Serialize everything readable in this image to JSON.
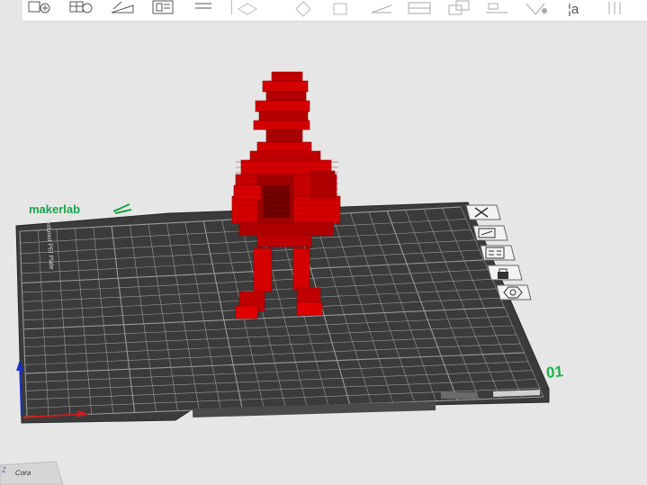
{
  "toolbar": {
    "items": [
      {
        "name": "add-object-icon",
        "label": "Add"
      },
      {
        "name": "add-plate-icon",
        "label": "Add plate"
      },
      {
        "name": "orient-icon",
        "label": "Orient"
      },
      {
        "name": "arrange-icon",
        "label": "Arrange"
      },
      {
        "name": "split-icon",
        "label": "Split"
      },
      {
        "name": "move-icon",
        "label": "Move"
      },
      {
        "name": "rotate-icon",
        "label": "Rotate"
      },
      {
        "name": "scale-icon",
        "label": "Scale"
      },
      {
        "name": "lay-on-face-icon",
        "label": "Lay on face"
      },
      {
        "name": "cut-icon",
        "label": "Cut"
      },
      {
        "name": "mesh-boolean-icon",
        "label": "Boolean"
      },
      {
        "name": "support-paint-icon",
        "label": "Supports"
      },
      {
        "name": "color-paint-icon",
        "label": "Color painting"
      },
      {
        "name": "text-icon",
        "label": "Text"
      },
      {
        "name": "measure-icon",
        "label": "Measure"
      }
    ]
  },
  "plate": {
    "brand": "makerlab",
    "number": "01",
    "side_tools": [
      {
        "name": "delete-plate-icon"
      },
      {
        "name": "orient-plate-icon"
      },
      {
        "name": "arrange-plate-icon"
      },
      {
        "name": "lock-plate-icon"
      },
      {
        "name": "plate-settings-icon"
      }
    ],
    "sheet_edge_text": "Textured PEI Plate"
  },
  "model": {
    "name": "voxel-figure",
    "color": "#d40000"
  },
  "camera": {
    "label": "Cora",
    "axis_label": "Z"
  },
  "colors": {
    "accent": "#1aa34a",
    "plate": "#3b3b3b",
    "grid": "#9a9a9a",
    "model": "#d40000",
    "background": "#e6e6e6"
  }
}
